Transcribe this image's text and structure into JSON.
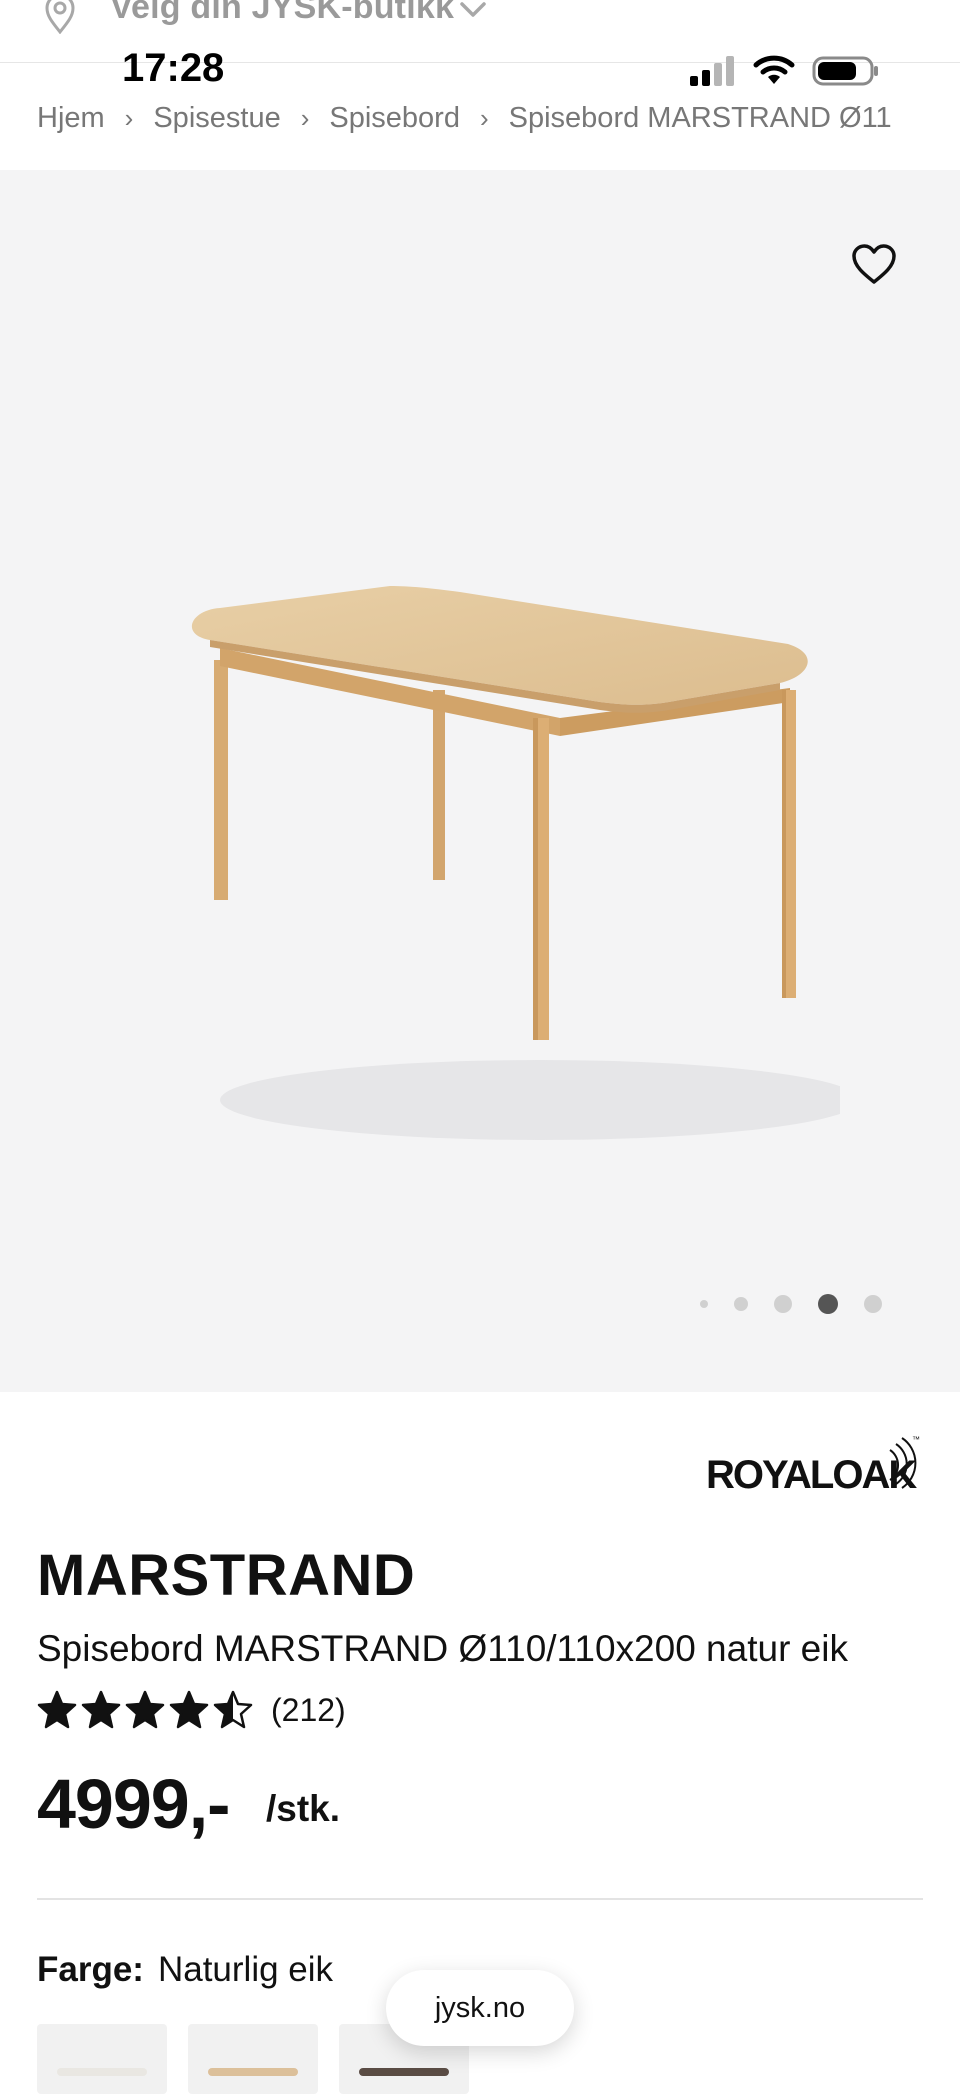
{
  "store_bar": {
    "label": "Velg din JYSK-butikk",
    "icon": "location-pin-icon"
  },
  "status_bar": {
    "time": "17:28"
  },
  "breadcrumb": {
    "items": [
      "Hjem",
      "Spisestue",
      "Spisebord",
      "Spisebord MARSTRAND Ø11"
    ],
    "separator": "›"
  },
  "gallery": {
    "total_images": 5,
    "active_index": 3,
    "favorite_icon": "heart-icon"
  },
  "product": {
    "brand": "ROYALOAK",
    "brand_mark": "™",
    "name": "MARSTRAND",
    "description": "Spisebord MARSTRAND Ø110/110x200 natur eik",
    "rating": 4.5,
    "rating_count": "(212)",
    "price": "4999,-",
    "unit": "/stk."
  },
  "color_selector": {
    "label": "Farge:",
    "value": "Naturlig eik"
  },
  "browser": {
    "url": "jysk.no"
  },
  "colors": {
    "wood": "#e2c49a",
    "wood_dark": "#c99f6b",
    "image_bg": "#f4f4f5",
    "active_dot": "#555555",
    "inactive_dot": "#d0d0d0"
  }
}
